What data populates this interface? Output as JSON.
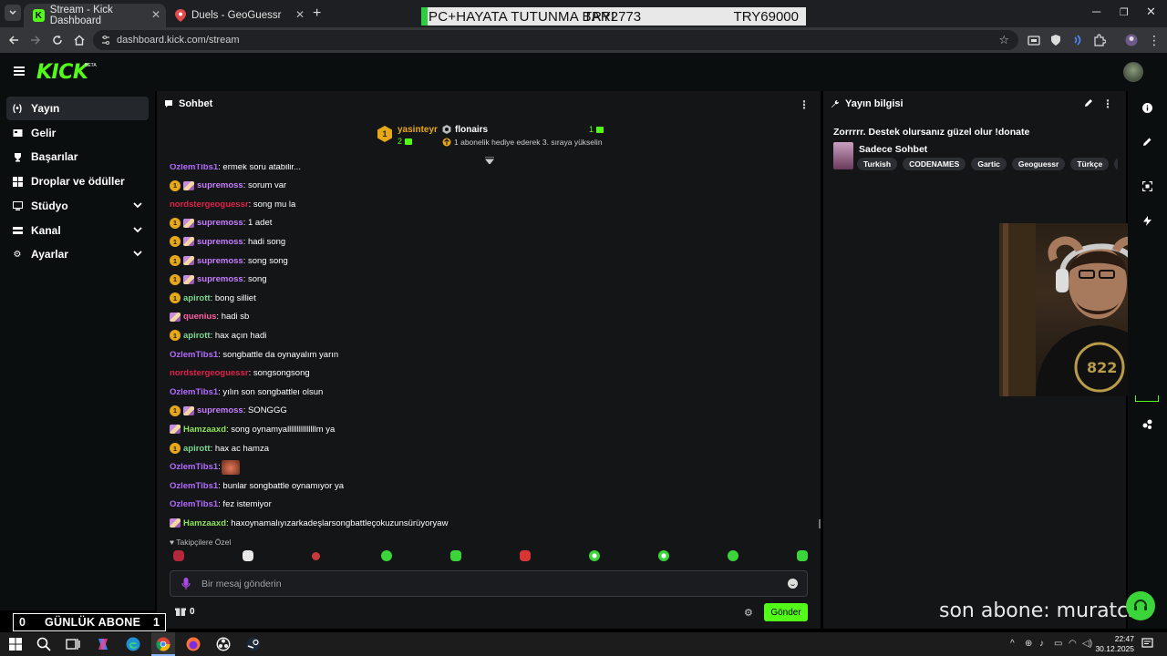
{
  "browser": {
    "tabs": [
      {
        "title": "Stream - Kick Dashboard",
        "active": true
      },
      {
        "title": "Duels - GeoGuessr",
        "active": false
      }
    ],
    "url": "dashboard.kick.com/stream"
  },
  "donation_bar": {
    "text_left": "PC+HAYATA TUTUNMA BARI",
    "text_mid": "TRY2773",
    "text_right": "TRY69000"
  },
  "kick": {
    "logo": "KICK",
    "logo_suffix": "BETA"
  },
  "sidebar": {
    "items": [
      {
        "label": "Yayın",
        "icon": "broadcast-icon",
        "selected": true
      },
      {
        "label": "Gelir",
        "icon": "revenue-icon"
      },
      {
        "label": "Başarılar",
        "icon": "trophy-icon"
      },
      {
        "label": "Droplar ve ödüller",
        "icon": "grid-icon"
      },
      {
        "label": "Stüdyo",
        "icon": "studio-icon",
        "expandable": true
      },
      {
        "label": "Kanal",
        "icon": "channel-icon",
        "expandable": true
      },
      {
        "label": "Ayarlar",
        "icon": "gear-icon",
        "expandable": true
      }
    ]
  },
  "chat": {
    "title": "Sohbet",
    "pinned": {
      "left_user": "yasinteyr",
      "left_count": "2",
      "right_user": "flonairs",
      "right_count": "1",
      "note": "1 abonelik hediye ederek 3. sıraya yükselin"
    },
    "messages": [
      {
        "user": "OzlemTibs1",
        "text": ": ermek soru atabilir...",
        "color": "#b36bff",
        "badges": []
      },
      {
        "user": "supremoss",
        "text": ": sorum var",
        "color": "#c77dff",
        "badges": [
          "1",
          "gift"
        ]
      },
      {
        "user": "nordstergeoguessr",
        "text": ": song mu la",
        "color": "#e0204a",
        "badges": []
      },
      {
        "user": "supremoss",
        "text": ": 1 adet",
        "color": "#c77dff",
        "badges": [
          "1",
          "gift"
        ]
      },
      {
        "user": "supremoss",
        "text": ": hadi song",
        "color": "#c77dff",
        "badges": [
          "1",
          "gift"
        ]
      },
      {
        "user": "supremoss",
        "text": ": song song",
        "color": "#c77dff",
        "badges": [
          "1",
          "gift"
        ]
      },
      {
        "user": "supremoss",
        "text": ": song",
        "color": "#c77dff",
        "badges": [
          "1",
          "gift"
        ]
      },
      {
        "user": "apirott",
        "text": ": bong silliet",
        "color": "#7bd88f",
        "badges": [
          "1"
        ]
      },
      {
        "user": "quenius",
        "text": ": hadi sb",
        "color": "#ff5fa2",
        "badges": [
          "gift"
        ]
      },
      {
        "user": "apirott",
        "text": ": hax açın hadi",
        "color": "#7bd88f",
        "badges": [
          "1"
        ]
      },
      {
        "user": "OzlemTibs1",
        "text": ": songbattle da oynayalım yarın",
        "color": "#b36bff",
        "badges": []
      },
      {
        "user": "nordstergeoguessr",
        "text": ": songsongsong",
        "color": "#e0204a",
        "badges": []
      },
      {
        "user": "OzlemTibs1",
        "text": ": yılın son songbattleı olsun",
        "color": "#b36bff",
        "badges": []
      },
      {
        "user": "supremoss",
        "text": ": SONGGG",
        "color": "#c77dff",
        "badges": [
          "1",
          "gift"
        ]
      },
      {
        "user": "Hamzaaxd",
        "text": ": song oynamyalllllllllllllllm ya",
        "color": "#8fe35a",
        "badges": [
          "gift"
        ]
      },
      {
        "user": "apirott",
        "text": ": hax ac hamza",
        "color": "#7bd88f",
        "badges": [
          "1"
        ]
      },
      {
        "user": "OzlemTibs1",
        "text": ":",
        "color": "#b36bff",
        "badges": [],
        "emote": true
      },
      {
        "user": "OzlemTibs1",
        "text": ": bunlar songbattle oynamıyor ya",
        "color": "#b36bff",
        "badges": []
      },
      {
        "user": "OzlemTibs1",
        "text": ": fez istemiyor",
        "color": "#b36bff",
        "badges": []
      },
      {
        "user": "Hamzaaxd",
        "text": ": haxoynamalıyızarkadeşlarsongbattleçokuzunsürüyoryaw",
        "color": "#8fe35a",
        "badges": [
          "gift"
        ]
      }
    ],
    "emote_section_label": "Takipçilere Özel",
    "input_placeholder": "Bir mesaj gönderin",
    "gift_count": "0",
    "send_label": "Gönder"
  },
  "stream_info": {
    "title": "Yayın bilgisi",
    "stream_title": "Zorrrrr. Destek olursanız güzel olur !donate",
    "category": "Sadece Sohbet",
    "tags": [
      "Turkish",
      "CODENAMES",
      "Gartic",
      "Geoguessr",
      "Türkçe",
      "gartich"
    ]
  },
  "overlays": {
    "sub_goal_left": "0",
    "sub_goal_label": "GÜNLÜK ABONE",
    "sub_goal_right": "1",
    "last_sub": "son abone: muratcsr"
  },
  "taskbar": {
    "time": "22:47",
    "date": "30.12.2025"
  }
}
